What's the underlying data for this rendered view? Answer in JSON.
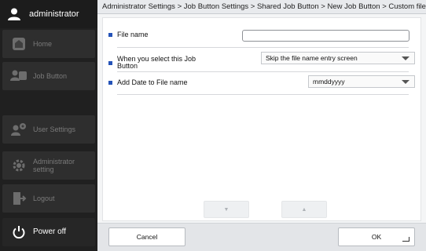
{
  "sidebar": {
    "user": {
      "label": "administrator",
      "icon": "user-icon"
    },
    "items": [
      {
        "key": "home",
        "label": "Home",
        "icon": "home-icon",
        "enabled": false
      },
      {
        "key": "job-button",
        "label": "Job Button",
        "icon": "job-button-icon",
        "enabled": false
      },
      {
        "key": "user-settings",
        "label": "User Settings",
        "icon": "user-settings-icon",
        "enabled": false
      },
      {
        "key": "admin-setting",
        "label_line1": "Administrator",
        "label_line2": "setting",
        "icon": "gear-icon",
        "enabled": false
      },
      {
        "key": "logout",
        "label": "Logout",
        "icon": "logout-icon",
        "enabled": false
      },
      {
        "key": "power-off",
        "label": "Power off",
        "icon": "power-icon",
        "enabled": true
      }
    ]
  },
  "header": {
    "breadcrumb": "Administrator Settings > Job Button Settings > Shared Job Button > New Job Button > Custom file name Settings"
  },
  "form": {
    "file_name": {
      "label": "File name",
      "value": "",
      "placeholder": ""
    },
    "when_select": {
      "label_line1": "When you select this Job",
      "label_line2": "Button",
      "selected": "Skip the file name entry screen"
    },
    "add_date": {
      "label": "Add Date to File name",
      "selected": "mmddyyyy"
    }
  },
  "footer": {
    "scroll_down": "▼",
    "scroll_up": "▲",
    "cancel_label": "Cancel",
    "ok_label": "OK"
  },
  "colors": {
    "sidebar_bg": "#202020",
    "bullet": "#2553b8",
    "main_bg": "#f4f5f6"
  }
}
